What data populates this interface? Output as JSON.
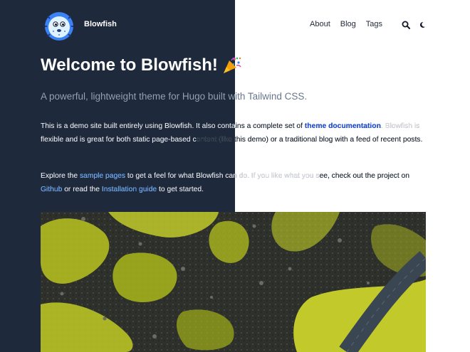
{
  "header": {
    "site_title": "Blowfish",
    "nav": [
      {
        "label": "About"
      },
      {
        "label": "Blog"
      },
      {
        "label": "Tags"
      }
    ]
  },
  "main": {
    "title": "Welcome to Blowfish!",
    "subtitle": "A powerful, lightweight theme for Hugo built with Tailwind CSS.",
    "para1": {
      "before": "This is a demo site built entirely using Blowfish. It also contains a complete set of ",
      "link": "theme documentation",
      "after": ". Blowfish is flexible and is great for both static page-based content (like this demo) or a traditional blog with a feed of recent posts."
    },
    "para2": {
      "t1": "Explore the ",
      "link1": "sample pages",
      "t2": " to get a feel for what Blowfish can do. If you like what you see, check out the project on ",
      "link2": "Github",
      "t3": " or read the ",
      "link3": "Installation guide",
      "t4": " to get started."
    }
  },
  "colors": {
    "dark_bg": "#1e293b",
    "link_dark": "#60a5fa",
    "link_light": "#1d4ed8",
    "hero_moss": "#c9d42a"
  },
  "icons": [
    "blowfish-logo",
    "search-icon",
    "moon-icon",
    "party-popper-icon"
  ]
}
